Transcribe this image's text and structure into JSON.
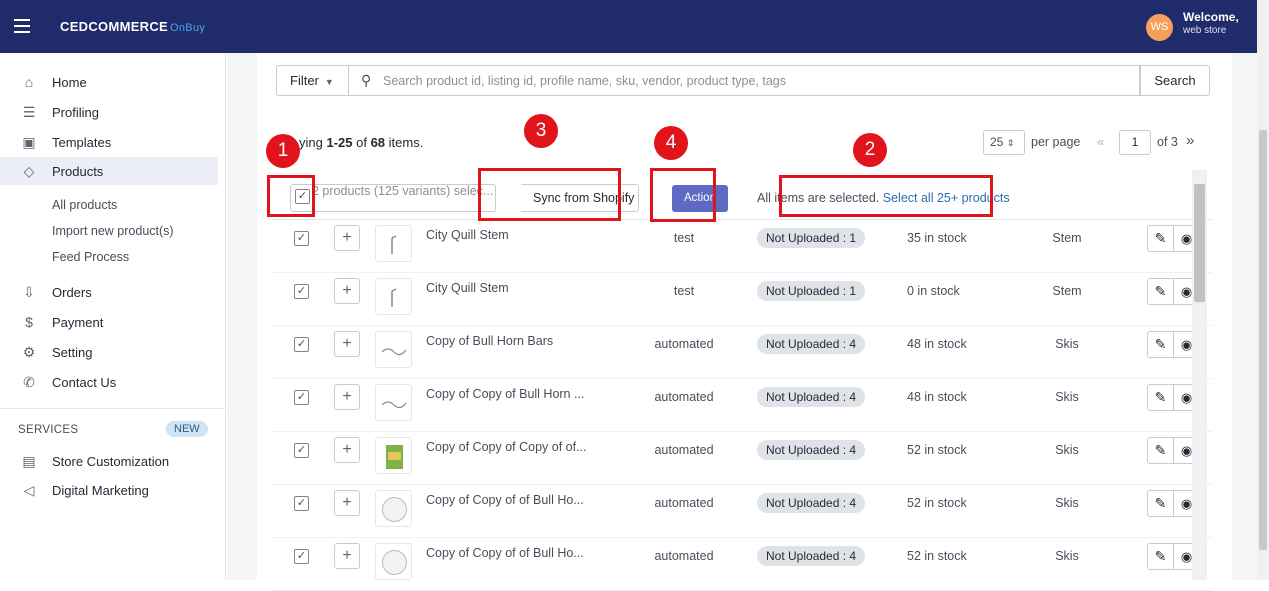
{
  "header": {
    "brand": "CEDCOMMERCE",
    "brand_sub": "OnBuy",
    "avatar_initials": "WS",
    "welcome": "Welcome,",
    "store": "web store"
  },
  "sidebar": {
    "items": [
      {
        "label": "Home",
        "icon": "home-icon",
        "glyph": "⌂"
      },
      {
        "label": "Profiling",
        "icon": "profiling-icon",
        "glyph": "☰"
      },
      {
        "label": "Templates",
        "icon": "templates-icon",
        "glyph": "▣"
      },
      {
        "label": "Products",
        "icon": "tag-icon",
        "glyph": "◇"
      },
      {
        "label": "Orders",
        "icon": "orders-icon",
        "glyph": "⇩"
      },
      {
        "label": "Payment",
        "icon": "payment-icon",
        "glyph": "$"
      },
      {
        "label": "Setting",
        "icon": "gear-icon",
        "glyph": "⚙"
      },
      {
        "label": "Contact Us",
        "icon": "contact-icon",
        "glyph": "✆"
      }
    ],
    "sub_items": [
      "All products",
      "Import new product(s)",
      "Feed Process"
    ],
    "services_label": "SERVICES",
    "new_badge": "NEW",
    "services": [
      {
        "label": "Store Customization",
        "icon": "store-icon",
        "glyph": "▤"
      },
      {
        "label": "Digital Marketing",
        "icon": "megaphone-icon",
        "glyph": "◁"
      }
    ]
  },
  "toolbar": {
    "filter_label": "Filter",
    "search_placeholder": "Search product id, listing id, profile name, sku, vendor, product type, tags",
    "search_button": "Search"
  },
  "pagination": {
    "showing_prefix": "ying ",
    "showing_range": "1-25",
    "showing_of": " of ",
    "showing_total": "68",
    "showing_suffix": " items.",
    "per_page_value": "25",
    "per_page_label": "per page",
    "prev": "«",
    "current_page": "1",
    "of_pages": "of 3",
    "next": "»"
  },
  "bulk": {
    "checkbox_mark": "✓",
    "selected_text": "2  products (125 variants) selec...",
    "sync_option": "Sync from Shopify",
    "action_button": "Action",
    "all_selected_text": "All items are selected.",
    "select_all_link": "Select all 25+ products"
  },
  "annotations": [
    "1",
    "2",
    "3",
    "4"
  ],
  "products": [
    {
      "title": "City Quill Stem",
      "vendor": "test",
      "status": "Not Uploaded : 1",
      "stock": "35 in stock",
      "type": "Stem"
    },
    {
      "title": "City Quill Stem",
      "vendor": "test",
      "status": "Not Uploaded : 1",
      "stock": "0 in stock",
      "type": "Stem"
    },
    {
      "title": "Copy of Bull Horn Bars",
      "vendor": "automated",
      "status": "Not Uploaded : 4",
      "stock": "48 in stock",
      "type": "Skis"
    },
    {
      "title": "Copy of Copy of Bull Horn ...",
      "vendor": "automated",
      "status": "Not Uploaded : 4",
      "stock": "48 in stock",
      "type": "Skis"
    },
    {
      "title": "Copy of Copy of Copy of of...",
      "vendor": "automated",
      "status": "Not Uploaded : 4",
      "stock": "52 in stock",
      "type": "Skis"
    },
    {
      "title": "Copy of Copy of of Bull Ho...",
      "vendor": "automated",
      "status": "Not Uploaded : 4",
      "stock": "52 in stock",
      "type": "Skis"
    },
    {
      "title": "Copy of Copy of of Bull Ho...",
      "vendor": "automated",
      "status": "Not Uploaded : 4",
      "stock": "52 in stock",
      "type": "Skis"
    }
  ],
  "colors": {
    "topbar": "#1f2b6b",
    "action": "#5c6ac4",
    "annotation": "#e1141b",
    "link": "#2a6fb3"
  }
}
